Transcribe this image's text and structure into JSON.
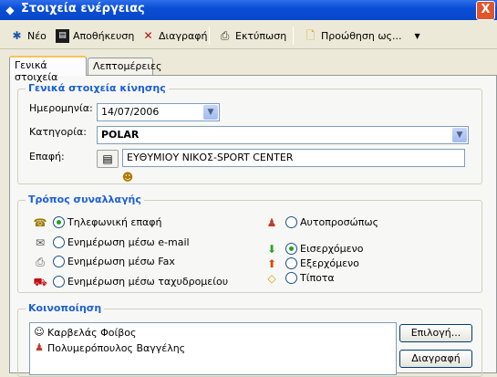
{
  "window": {
    "title": "Στοιχεία ενέργειας",
    "close_glyph": "X"
  },
  "toolbar": {
    "new_label": "Νέο",
    "save_label": "Αποθήκευση",
    "delete_label": "Διαγραφή",
    "print_label": "Εκτύπωση",
    "forward_label": "Προώθηση ως..."
  },
  "tabs": [
    "Γενικά στοιχεία",
    "Λεπτομέρειες"
  ],
  "general": {
    "title": "Γενικά στοιχεία κίνησης",
    "date_label": "Ημερομηνία:",
    "date_value": "14/07/2006",
    "category_label": "Κατηγορία:",
    "category_value": "POLAR",
    "contact_label": "Επαφή:",
    "contact_value": "ΕΥΘΥΜΙΟΥ ΝΙΚΟΣ-SPORT CENTER"
  },
  "transaction": {
    "title": "Τρόπος συναλλαγής",
    "phone": "Τηλεφωνική επαφή",
    "email": "Ενημέρωση μέσω e-mail",
    "fax": "Ενημέρωση μέσω Fax",
    "mail": "Ενημέρωση μέσω ταχυδρομείου",
    "in_person": "Αυτοπροσώπως",
    "incoming": "Εισερχόμενο",
    "outgoing": "Εξερχόμενο",
    "nothing": "Τίποτα",
    "selected_method": "phone",
    "selected_direction": "incoming"
  },
  "notify": {
    "title": "Κοινοποίηση",
    "items": [
      "Καρβελάς Φοίβος",
      "Πολυμερόπουλος Βαγγέλης"
    ],
    "select_label": "Επιλογή...",
    "delete_label": "Διαγραφή"
  }
}
